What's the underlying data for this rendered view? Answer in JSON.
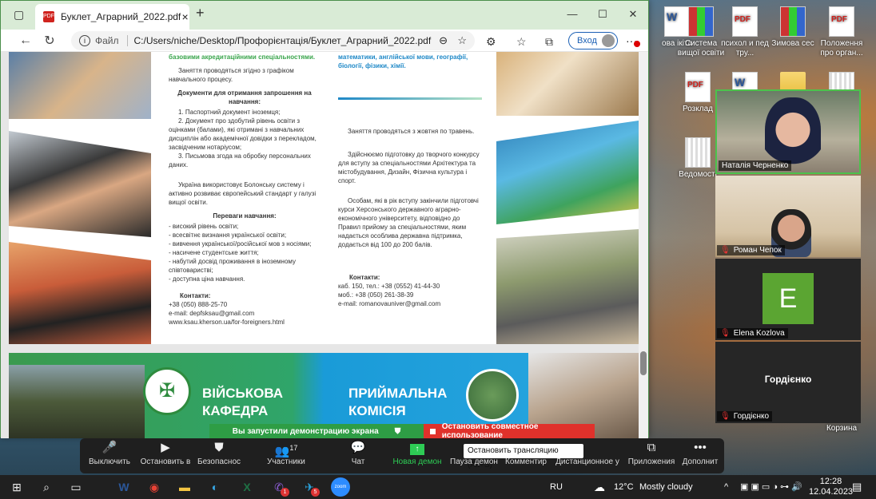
{
  "desktop": {
    "icons": [
      {
        "label": "ова ікіта",
        "type": "doc"
      },
      {
        "label": "Система вищої освіти",
        "type": "pack"
      },
      {
        "label": "психол и пед тру...",
        "type": "pdf"
      },
      {
        "label": "Зимова сес",
        "type": "pack"
      },
      {
        "label": "Положення про орган...",
        "type": "pdf"
      },
      {
        "label": "Розклад",
        "type": "pdf"
      },
      {
        "label": "",
        "type": "doc"
      },
      {
        "label": "",
        "type": "folder"
      },
      {
        "label": "",
        "type": "archive"
      },
      {
        "label": "Ведомості",
        "type": "archive"
      },
      {
        "label": "Корзина",
        "type": "archive"
      }
    ]
  },
  "browser": {
    "tab_title": "Буклет_Аграрний_2022.pdf",
    "pdf_icon": "PDF",
    "url_label": "Файл",
    "url": "C:/Users/niche/Desktop/Профорієнтація/Буклет_Аграрний_2022.pdf",
    "signin": "Вход",
    "new_tab": "+",
    "close_tab": "×"
  },
  "pdf": {
    "col1": {
      "intro": "базовими акредитаційними спеціальностями.",
      "schedule": "Заняття проводяться згідно з графіком навчального процесу.",
      "docs_heading": "Документи для отримання запрошення на навчання:",
      "docs": [
        "1. Паспортний документ іноземця;",
        "2. Документ про здобутий рівень освіти з оцінками (балами), які отримані з навчальних дисциплін або академічної довідки з перекладом, засвідченим нотаріусом;",
        "3. Письмова згода на обробку персональних даних."
      ],
      "bologna": "Україна використовує Болонську систему і активно розвиває європейський стандарт у галузі вищої освіти.",
      "adv_heading": "Переваги навчання:",
      "adv": [
        "- високий рівень освіти;",
        "- всесвітнє визнання української освіти;",
        "- вивчення української/російської мов з носіями;",
        "- насичене студентське життя;",
        "- набутий досвід проживання в іноземному співтоваристві;",
        "- доступна ціна навчання."
      ],
      "contacts_heading": "Контакти:",
      "contacts": [
        "+38 (050) 888-25-70",
        "e-mail: depfsksau@gmail.com",
        "www.ksau.kherson.ua/for-foreigners.html"
      ]
    },
    "col2": {
      "intro": "математики, англійської мови, географії, біології, фізики, хімії.",
      "p1": "Заняття проводяться з жовтня по травень.",
      "p2": "Здійснюємо підготовку до творчого конкурсу для вступу за спеціальностями Архітектура та містобудування, Дизайн, Фізична культура і спорт.",
      "p3": "Особам, які в рік вступу закінчили підготовчі курси Херсонського державного аграрно-економічного університету, відповідно до Правил прийому за спеціальностями, яким надається особлива державна підтримка, додається від 100 до 200 балів.",
      "contacts_heading": "Контакти:",
      "contacts": [
        "каб. 150, тел.: +38 (0552) 41-44-30",
        "моб.: +38 (050) 261-38-39",
        "e-mail: romanovauniver@gmail.com"
      ]
    },
    "page2": {
      "left_title_1": "ВІЙСЬКОВА",
      "left_title_2": "КАФЕДРА",
      "right_title_1": "ПРИЙМАЛЬНА",
      "right_title_2": "КОМІСІЯ"
    }
  },
  "zoom": {
    "share_banner": "Вы запустили демонстрацию экрана",
    "stop_share": "Остановить совместное использование",
    "stop_input": "Остановить трансляцию (Alt+S)",
    "participants_count": "17",
    "toolbar": [
      {
        "label": "Выключить",
        "icon": "mic-icon"
      },
      {
        "label": "Остановить в",
        "icon": "video-icon"
      },
      {
        "label": "Безопаснос",
        "icon": "shield-icon"
      },
      {
        "label": "Участники",
        "icon": "people-icon"
      },
      {
        "label": "Чат",
        "icon": "chat-icon"
      },
      {
        "label": "Новая демон",
        "icon": "share-icon"
      },
      {
        "label": "Пауза демон",
        "icon": "pause-icon"
      },
      {
        "label": "Комментир",
        "icon": "pen-icon"
      },
      {
        "label": "Дистанционное у",
        "icon": "remote-icon"
      },
      {
        "label": "Приложения",
        "icon": "apps-icon"
      },
      {
        "label": "Дополнит",
        "icon": "more-icon"
      }
    ],
    "participants": [
      {
        "name": "Наталія Черненко"
      },
      {
        "name": "Роман Чепок"
      },
      {
        "name": "Elena Kozlova",
        "initial": "E"
      },
      {
        "name": "Гордієнко",
        "big": "Гордієнко"
      }
    ]
  },
  "taskbar": {
    "lang": "RU",
    "temp": "12°C",
    "weather": "Mostly cloudy",
    "time": "12:28",
    "date": "12.04.2023",
    "badge1": "1",
    "badge2": "5",
    "zoom_label": "zoom"
  }
}
